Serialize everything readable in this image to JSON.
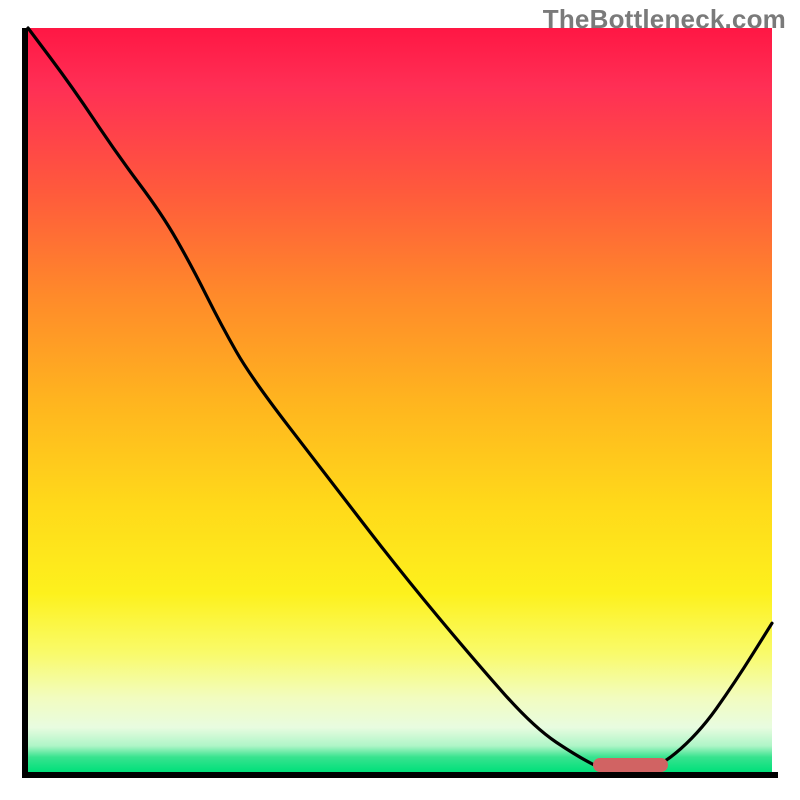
{
  "watermark": "TheBottleneck.com",
  "colors": {
    "gradient_top": "#ff1744",
    "gradient_bottom": "#00e07a",
    "axis": "#000000",
    "curve": "#000000",
    "marker": "#d16363",
    "watermark_text": "#7a7a7a"
  },
  "chart_data": {
    "type": "line",
    "title": "",
    "xlabel": "",
    "ylabel": "",
    "xlim": [
      0,
      100
    ],
    "ylim": [
      0,
      100
    ],
    "x": [
      0,
      6,
      12,
      18,
      22,
      26,
      30,
      40,
      50,
      60,
      68,
      74,
      78,
      84,
      90,
      95,
      100
    ],
    "values": [
      100,
      92,
      83,
      75,
      68,
      60,
      53,
      40,
      27,
      15,
      6,
      2,
      0,
      0,
      5,
      12,
      20
    ],
    "marker": {
      "x_start": 76,
      "x_end": 86,
      "y": 0
    }
  }
}
